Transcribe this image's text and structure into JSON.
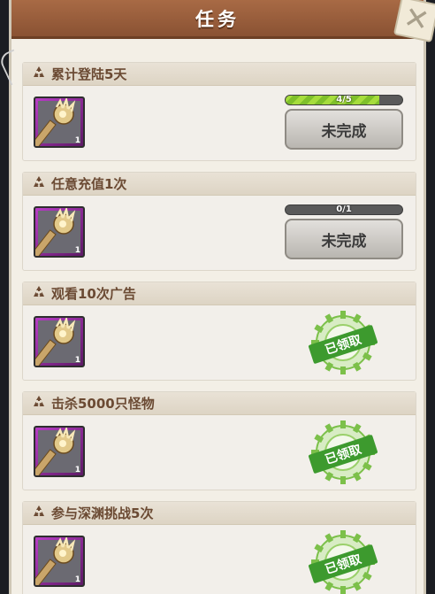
{
  "header": {
    "title": "任务",
    "close_icon": "close-x-icon"
  },
  "tasks": [
    {
      "title": "累计登陆5天",
      "icon": "recycle-icon",
      "item_count": "1",
      "progress": {
        "text": "4/5",
        "fraction": 0.8
      },
      "status": "button",
      "button_label": "未完成"
    },
    {
      "title": "任意充值1次",
      "icon": "recycle-icon",
      "item_count": "1",
      "progress": {
        "text": "0/1",
        "fraction": 0
      },
      "status": "button",
      "button_label": "未完成"
    },
    {
      "title": "观看10次广告",
      "icon": "recycle-icon",
      "item_count": "1",
      "status": "claimed",
      "stamp_label": "已领取"
    },
    {
      "title": "击杀5000只怪物",
      "icon": "recycle-icon",
      "item_count": "1",
      "status": "claimed",
      "stamp_label": "已领取"
    },
    {
      "title": "参与深渊挑战5次",
      "icon": "recycle-icon",
      "item_count": "1",
      "status": "claimed",
      "stamp_label": "已领取"
    }
  ],
  "colors": {
    "header": "#8a5233",
    "claimed_green": "#3d9a2e",
    "progress_green": "#a6dd3c"
  }
}
